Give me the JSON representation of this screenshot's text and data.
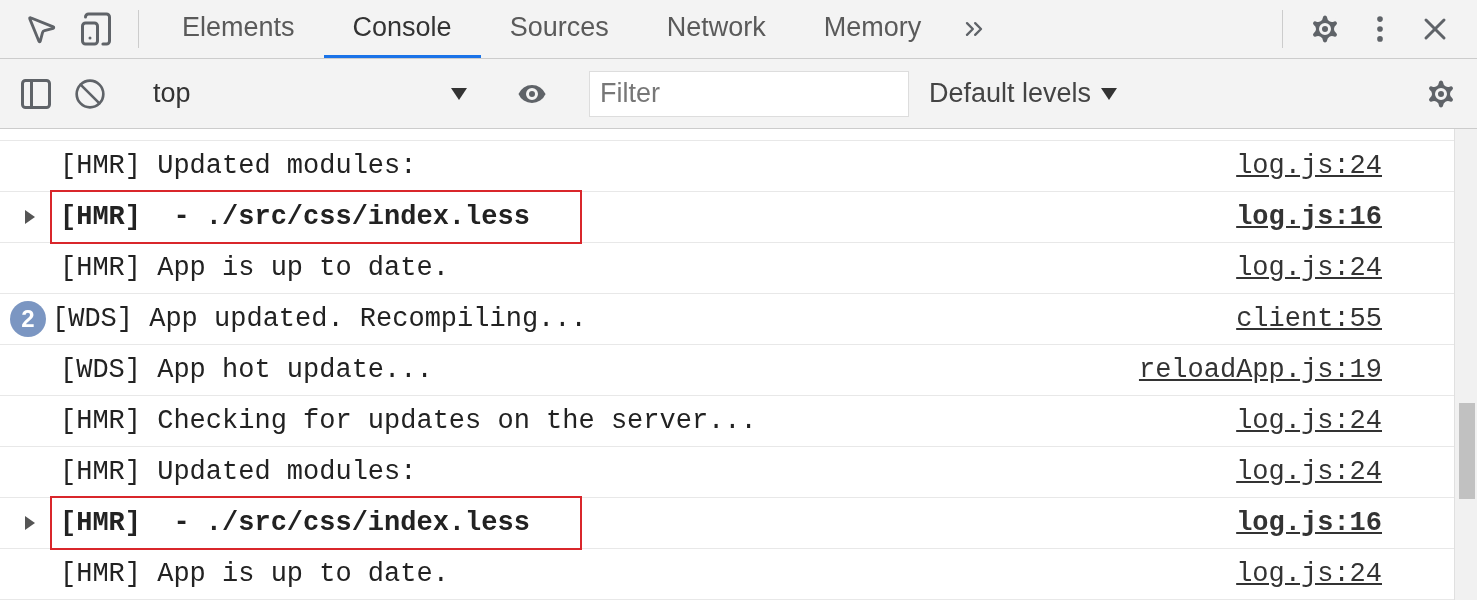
{
  "tabs": [
    {
      "label": "Elements",
      "selected": false
    },
    {
      "label": "Console",
      "selected": true
    },
    {
      "label": "Sources",
      "selected": false
    },
    {
      "label": "Network",
      "selected": false
    },
    {
      "label": "Memory",
      "selected": false
    }
  ],
  "toolbar": {
    "context": "top",
    "filter": {
      "placeholder": "Filter"
    },
    "levels": "Default levels"
  },
  "rows": [
    {
      "kind": "log",
      "message": "[HMR] Updated modules:",
      "source": "log.js:24",
      "highlighted": false
    },
    {
      "kind": "group",
      "message": "[HMR]  - ./src/css/index.less",
      "source": "log.js:16",
      "highlighted": true
    },
    {
      "kind": "log",
      "message": "[HMR] App is up to date.",
      "source": "log.js:24",
      "highlighted": false
    },
    {
      "kind": "badge",
      "count": "2",
      "message": "[WDS] App updated. Recompiling...",
      "source": "client:55",
      "highlighted": false
    },
    {
      "kind": "log",
      "message": "[WDS] App hot update...",
      "source": "reloadApp.js:19",
      "highlighted": false
    },
    {
      "kind": "log",
      "message": "[HMR] Checking for updates on the server...",
      "source": "log.js:24",
      "highlighted": false
    },
    {
      "kind": "log",
      "message": "[HMR] Updated modules:",
      "source": "log.js:24",
      "highlighted": false
    },
    {
      "kind": "group",
      "message": "[HMR]  - ./src/css/index.less",
      "source": "log.js:16",
      "highlighted": true
    },
    {
      "kind": "log",
      "message": "[HMR] App is up to date.",
      "source": "log.js:24",
      "highlighted": false
    }
  ]
}
